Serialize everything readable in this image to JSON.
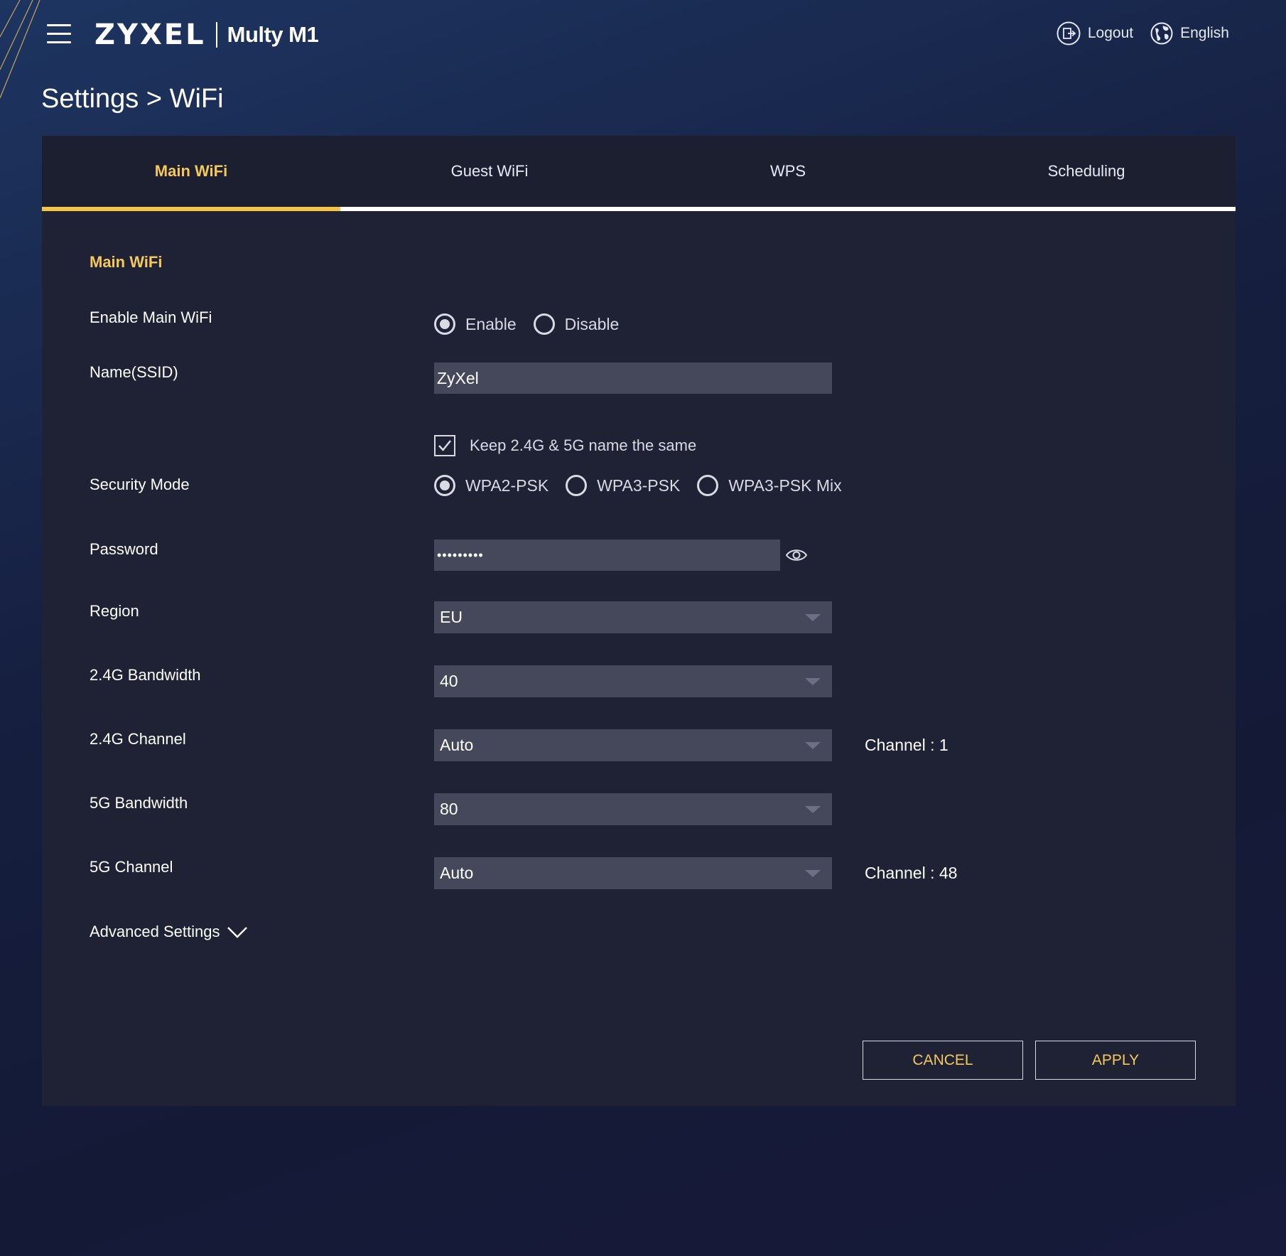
{
  "header": {
    "brand": "ZYXEL",
    "model": "Multy M1",
    "logout_label": "Logout",
    "language_label": "English"
  },
  "page_title": "Settings > WiFi",
  "tabs": [
    {
      "label": "Main WiFi",
      "active": true
    },
    {
      "label": "Guest WiFi",
      "active": false
    },
    {
      "label": "WPS",
      "active": false
    },
    {
      "label": "Scheduling",
      "active": false
    }
  ],
  "form": {
    "section_title": "Main WiFi",
    "enable": {
      "label": "Enable Main WiFi",
      "options": [
        "Enable",
        "Disable"
      ],
      "selected": "Enable"
    },
    "ssid": {
      "label": "Name(SSID)",
      "value": "ZyXel"
    },
    "keep_same": {
      "label": "Keep 2.4G & 5G name the same",
      "checked": true
    },
    "security": {
      "label": "Security Mode",
      "options": [
        "WPA2-PSK",
        "WPA3-PSK",
        "WPA3-PSK Mix"
      ],
      "selected": "WPA2-PSK"
    },
    "password": {
      "label": "Password",
      "value": "•••••••••"
    },
    "region": {
      "label": "Region",
      "value": "EU"
    },
    "bw24": {
      "label": "2.4G Bandwidth",
      "value": "40"
    },
    "ch24": {
      "label": "2.4G Channel",
      "value": "Auto",
      "info": "Channel : 1"
    },
    "bw5": {
      "label": "5G Bandwidth",
      "value": "80"
    },
    "ch5": {
      "label": "5G Channel",
      "value": "Auto",
      "info": "Channel : 48"
    },
    "advanced_label": "Advanced Settings"
  },
  "buttons": {
    "cancel": "CANCEL",
    "apply": "APPLY"
  },
  "colors": {
    "accent": "#f5c443",
    "panel_bg": "#1f2235",
    "input_bg": "#45485a"
  }
}
